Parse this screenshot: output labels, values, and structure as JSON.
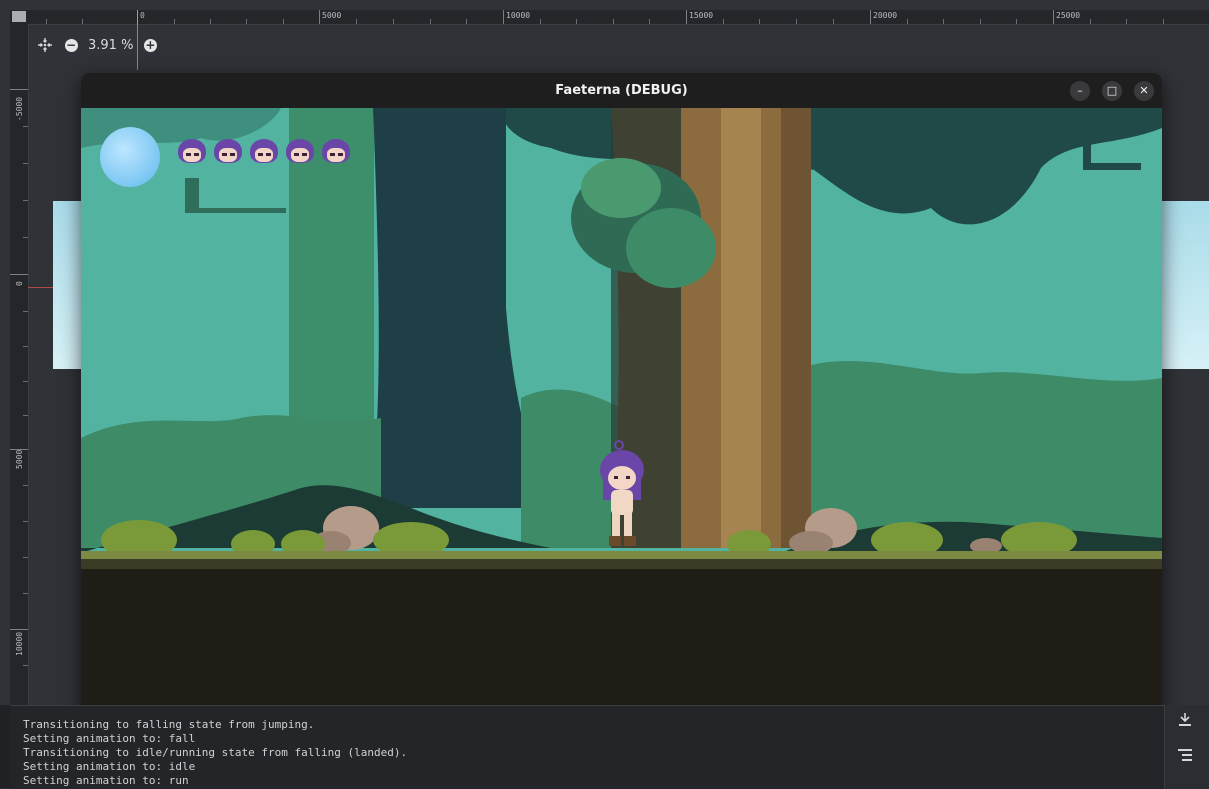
{
  "editor": {
    "ruler_top_labels": [
      "0",
      "5000",
      "10000",
      "15000",
      "20000",
      "25000"
    ],
    "ruler_left_labels": [
      "-5000",
      "0",
      "5000",
      "10000"
    ],
    "zoom": {
      "value_text": "3.91 %"
    }
  },
  "game_window": {
    "title": "Faeterna (DEBUG)",
    "controls": {
      "minimize": "–",
      "maximize": "□",
      "close": "✕"
    },
    "hud": {
      "lives": 5
    }
  },
  "console": {
    "lines": [
      "Transitioning to falling state from jumping.",
      "Setting animation to: fall",
      "Transitioning to idle/running state from falling (landed).",
      "Setting animation to: idle",
      "Setting animation to: run"
    ]
  },
  "icons": {
    "center_view": "center-view-icon",
    "zoom_out": "minus-circle-icon",
    "zoom_in": "plus-circle-icon"
  }
}
